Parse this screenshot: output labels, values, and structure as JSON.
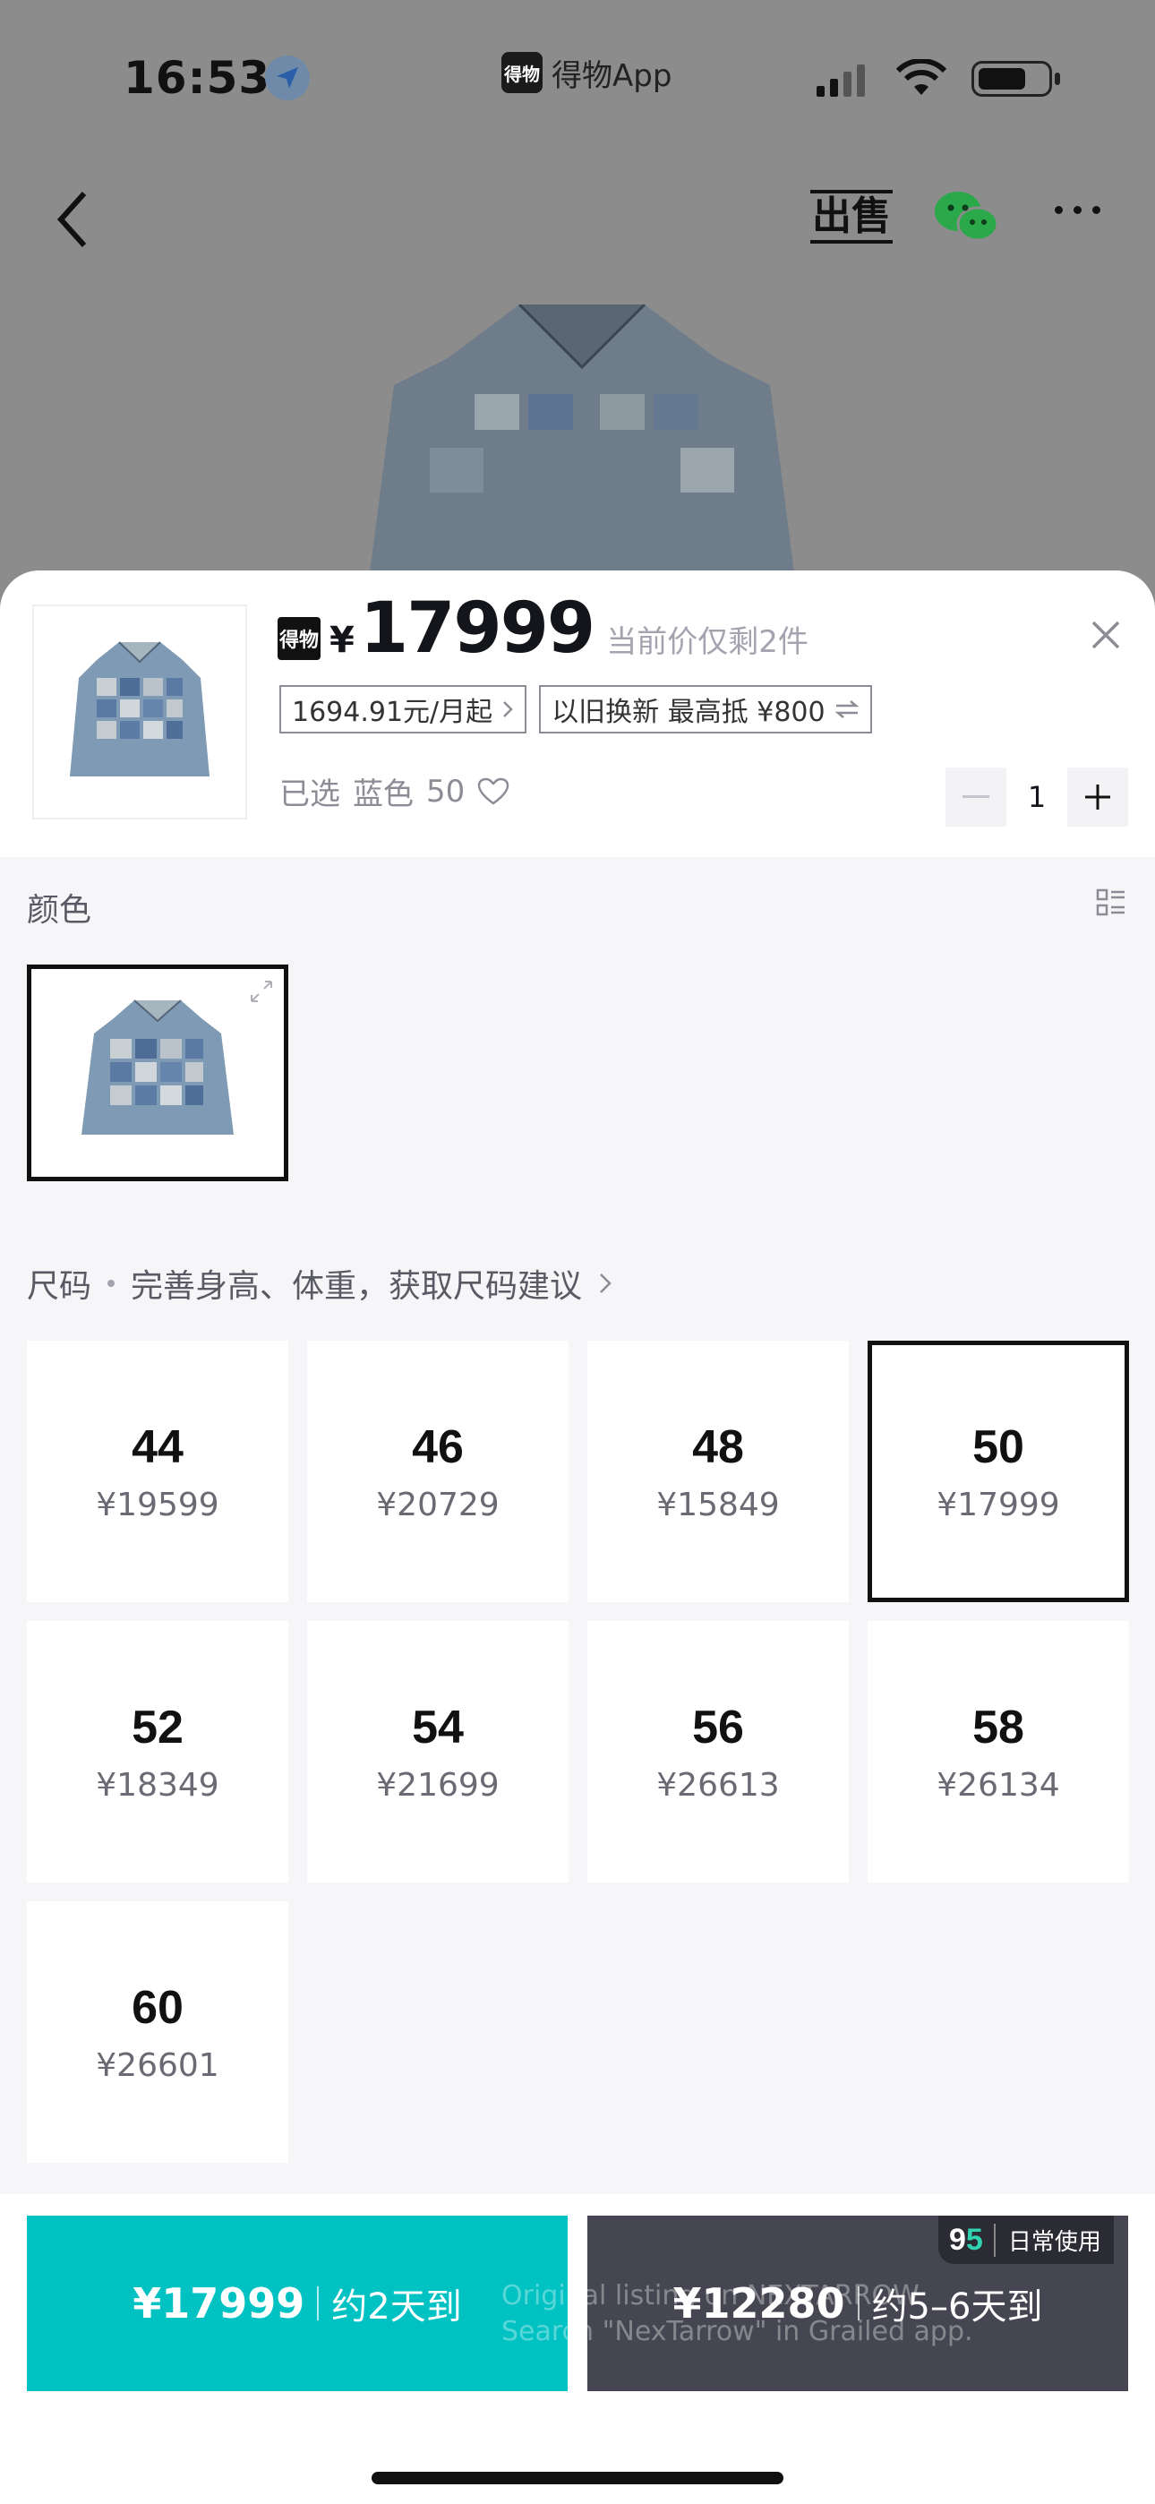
{
  "status": {
    "time": "16:53",
    "app_name": "得物App",
    "app_logo_text": "得物"
  },
  "nav": {
    "sell_label": "出售"
  },
  "header": {
    "brand_logo_text": "得物",
    "currency": "¥",
    "price": "17999",
    "stock_note": "当前价仅剩2件",
    "installment": "1694.91元/月起",
    "trade_in": "以旧换新 最高抵 ¥800",
    "selected_prefix": "已选",
    "selected_color": "蓝色",
    "selected_size": "50",
    "quantity": "1"
  },
  "color_section": {
    "label": "颜色",
    "options": [
      {
        "name": "蓝色",
        "selected": true
      }
    ]
  },
  "size_section": {
    "label": "尺码",
    "hint": "完善身高、体重，获取尺码建议",
    "sizes": [
      {
        "size": "44",
        "price": "¥19599"
      },
      {
        "size": "46",
        "price": "¥20729"
      },
      {
        "size": "48",
        "price": "¥15849"
      },
      {
        "size": "50",
        "price": "¥17999",
        "selected": true
      },
      {
        "size": "52",
        "price": "¥18349"
      },
      {
        "size": "54",
        "price": "¥21699"
      },
      {
        "size": "56",
        "price": "¥26613"
      },
      {
        "size": "58",
        "price": "¥26134"
      },
      {
        "size": "60",
        "price": "¥26601"
      }
    ]
  },
  "bottom": {
    "fast": {
      "price": "¥17999",
      "delivery": "约2天到"
    },
    "normal": {
      "price": "¥12280",
      "delivery": "约5–6天到"
    },
    "badge": {
      "score_a": "9",
      "score_b": "5",
      "label": "日常使用"
    },
    "watermark_line1": "Original listing on NEXTARROW",
    "watermark_line2": "Search \"NexTarrow\" in Grailed app."
  },
  "colors": {
    "accent_teal": "#01c2c3",
    "dark_button": "#454651",
    "selected_border": "#111111"
  }
}
